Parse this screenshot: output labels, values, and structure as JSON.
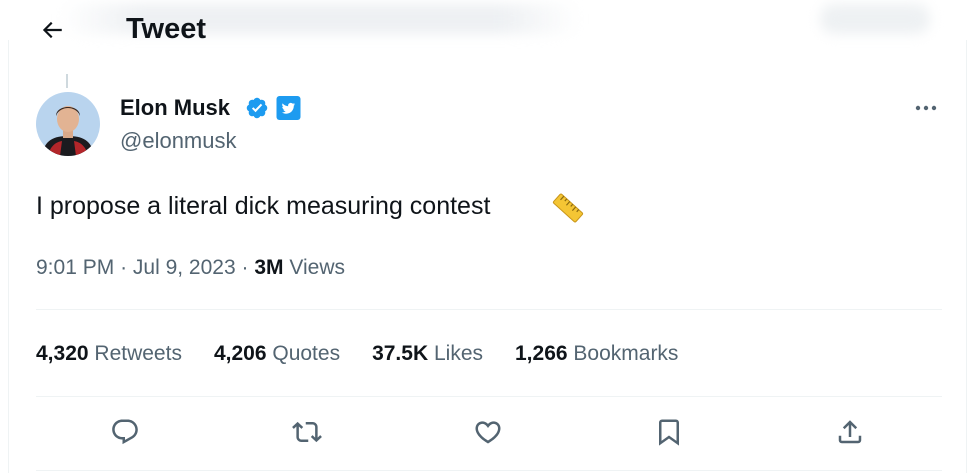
{
  "header": {
    "title": "Tweet",
    "back_icon": "arrow-left-icon"
  },
  "author": {
    "name": "Elon Musk",
    "handle": "@elonmusk",
    "verified_color": "#1d9bf0",
    "badge_icon": "twitter-bird-badge-icon"
  },
  "tweet": {
    "text": "I propose a literal dick measuring contest",
    "emoji_icon": "straight-ruler-icon",
    "time": "9:01 PM",
    "date": "Jul 9, 2023",
    "views_count": "3M",
    "views_label": "Views",
    "meta_sep": "·"
  },
  "stats": [
    {
      "count": "4,320",
      "label": "Retweets"
    },
    {
      "count": "4,206",
      "label": "Quotes"
    },
    {
      "count": "37.5K",
      "label": "Likes"
    },
    {
      "count": "1,266",
      "label": "Bookmarks"
    }
  ],
  "actions": [
    {
      "name": "reply",
      "icon": "reply-icon"
    },
    {
      "name": "retweet",
      "icon": "retweet-icon"
    },
    {
      "name": "like",
      "icon": "heart-icon"
    },
    {
      "name": "bookmark",
      "icon": "bookmark-icon"
    },
    {
      "name": "share",
      "icon": "share-icon"
    }
  ],
  "colors": {
    "text": "#0f1419",
    "secondary": "#536471",
    "accent": "#1d9bf0",
    "border": "#eff3f4"
  }
}
